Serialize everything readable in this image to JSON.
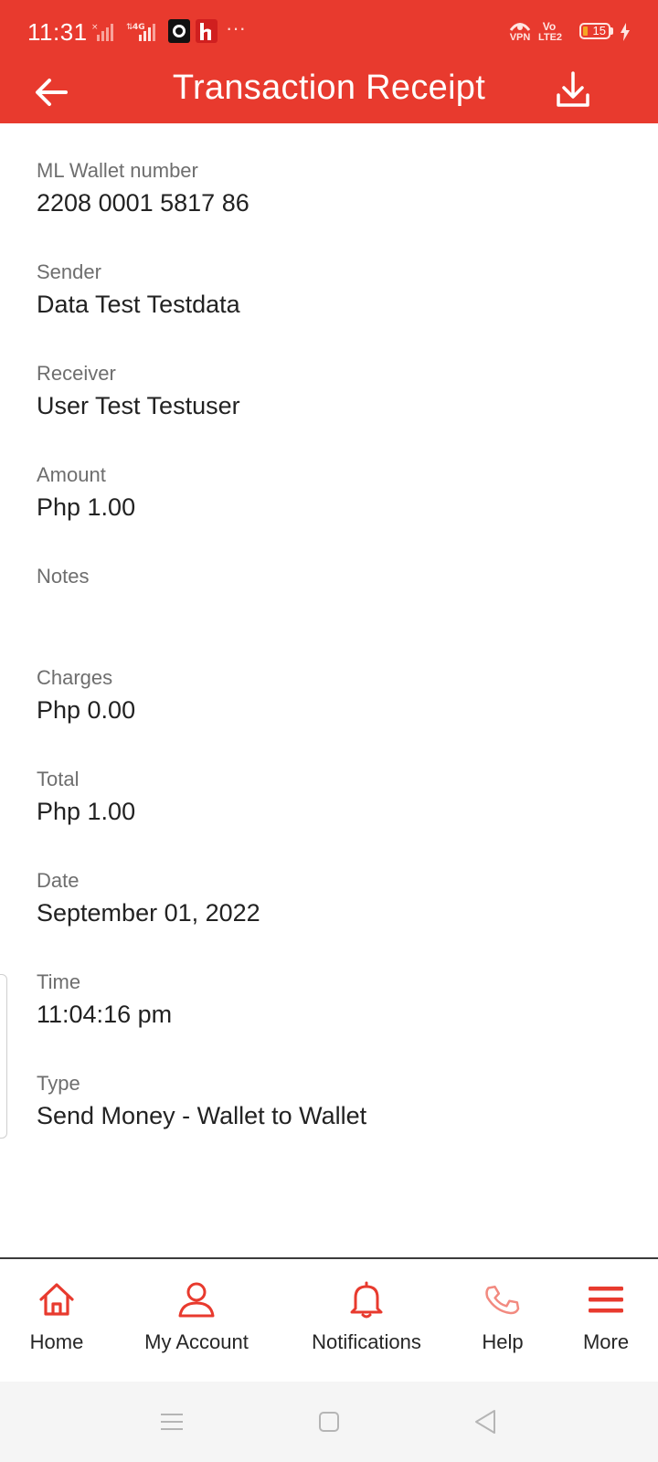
{
  "status_bar": {
    "time": "11:31",
    "network_4g": "4G",
    "dots": "···",
    "vpn": "VPN",
    "vo": "Vo",
    "lte": "LTE2",
    "battery": "15"
  },
  "header": {
    "title": "Transaction Receipt"
  },
  "receipt": [
    {
      "label": "ML Wallet number",
      "value": "2208 0001 5817 86"
    },
    {
      "label": "Sender",
      "value": "Data Test Testdata"
    },
    {
      "label": "Receiver",
      "value": "User Test Testuser"
    },
    {
      "label": "Amount",
      "value": "Php 1.00"
    },
    {
      "label": "Notes",
      "value": ""
    },
    {
      "label": "Charges",
      "value": "Php 0.00"
    },
    {
      "label": "Total",
      "value": "Php 1.00"
    },
    {
      "label": "Date",
      "value": "September 01, 2022"
    },
    {
      "label": "Time",
      "value": "11:04:16 pm"
    },
    {
      "label": "Type",
      "value": "Send Money - Wallet to Wallet"
    }
  ],
  "bottom_nav": [
    {
      "label": "Home",
      "icon": "home-icon"
    },
    {
      "label": "My Account",
      "icon": "user-icon"
    },
    {
      "label": "Notifications",
      "icon": "bell-icon"
    },
    {
      "label": "Help",
      "icon": "phone-icon"
    },
    {
      "label": "More",
      "icon": "menu-icon"
    }
  ],
  "colors": {
    "brand_red": "#e83a2e",
    "label_gray": "#6e6e6e"
  }
}
